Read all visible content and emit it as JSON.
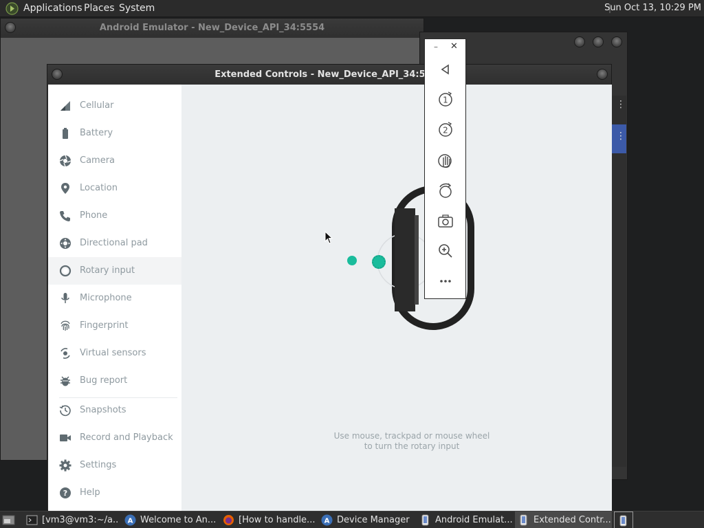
{
  "top_panel": {
    "menus": [
      "Applications",
      "Places",
      "System"
    ],
    "clock": "Sun Oct 13, 10:29 PM"
  },
  "emulator_window": {
    "title": "Android Emulator - New_Device_API_34:5554"
  },
  "extended_controls": {
    "title": "Extended Controls - New_Device_API_34:5554",
    "sidebar": [
      {
        "label": "Cellular",
        "icon": "cellular-icon"
      },
      {
        "label": "Battery",
        "icon": "battery-icon"
      },
      {
        "label": "Camera",
        "icon": "camera-icon"
      },
      {
        "label": "Location",
        "icon": "location-icon"
      },
      {
        "label": "Phone",
        "icon": "phone-icon"
      },
      {
        "label": "Directional pad",
        "icon": "dpad-icon"
      },
      {
        "label": "Rotary input",
        "icon": "rotary-icon",
        "active": true
      },
      {
        "label": "Microphone",
        "icon": "microphone-icon"
      },
      {
        "label": "Fingerprint",
        "icon": "fingerprint-icon"
      },
      {
        "label": "Virtual sensors",
        "icon": "virtual-sensors-icon"
      },
      {
        "label": "Bug report",
        "icon": "bug-icon"
      },
      {
        "label": "Snapshots",
        "icon": "snapshots-icon"
      },
      {
        "label": "Record and Playback",
        "icon": "record-icon"
      },
      {
        "label": "Settings",
        "icon": "gear-icon"
      },
      {
        "label": "Help",
        "icon": "help-icon"
      }
    ],
    "hint_line1": "Use mouse, trackpad or mouse wheel",
    "hint_line2": "to turn the rotary input",
    "accent_color": "#1abc9c"
  },
  "emulator_toolbar": {
    "min_label": "–",
    "close_label": "✕",
    "buttons": [
      "back-icon",
      "one-finger-rotate-icon",
      "two-finger-rotate-icon",
      "touch-icon",
      "rotate-icon",
      "screenshot-icon",
      "zoom-icon",
      "more-icon"
    ]
  },
  "taskbar": {
    "tasks": [
      {
        "label": "[vm3@vm3:~/a...",
        "icon": "terminal-icon"
      },
      {
        "label": "Welcome to An...",
        "icon": "android-studio-icon"
      },
      {
        "label": "[How to handle...",
        "icon": "firefox-icon"
      },
      {
        "label": "Device Manager",
        "icon": "android-studio-icon"
      },
      {
        "label": "Android Emulat...",
        "icon": "emulator-icon"
      },
      {
        "label": "Extended Contr...",
        "icon": "emulator-icon",
        "active": true
      }
    ]
  }
}
